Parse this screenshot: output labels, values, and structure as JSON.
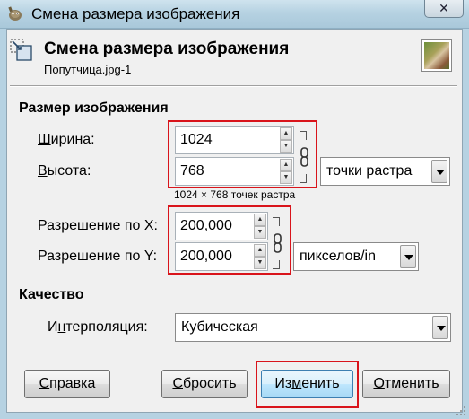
{
  "window": {
    "title": "Смена размера изображения",
    "close_glyph": "✕"
  },
  "header": {
    "title": "Смена размера изображения",
    "subtitle": "Попутчица.jpg-1"
  },
  "image_size": {
    "section_label": "Размер изображения",
    "width_label": "Ширина:",
    "width_value": "1024",
    "height_label": "Высота:",
    "height_value": "768",
    "unit": "точки растра",
    "dimensions_text": "1024 × 768 точек растра",
    "res_x_label": "Разрешение по X:",
    "res_x_value": "200,000",
    "res_y_label": "Разрешение по Y:",
    "res_y_value": "200,000",
    "res_unit": "пикселов/in"
  },
  "quality": {
    "section_label": "Качество",
    "interpolation_label": "Интерполяция:",
    "interpolation_value": "Кубическая"
  },
  "buttons": {
    "help": "Справка",
    "reset": "Сбросить",
    "apply": "Изменить",
    "cancel": "Отменить"
  },
  "colors": {
    "highlight": "#d9141b",
    "titlebar": "#b6d2e2"
  },
  "icons": [
    "gimp-app-icon",
    "scale-image-icon",
    "chain-link-icon",
    "close-icon",
    "resize-grip-icon"
  ]
}
